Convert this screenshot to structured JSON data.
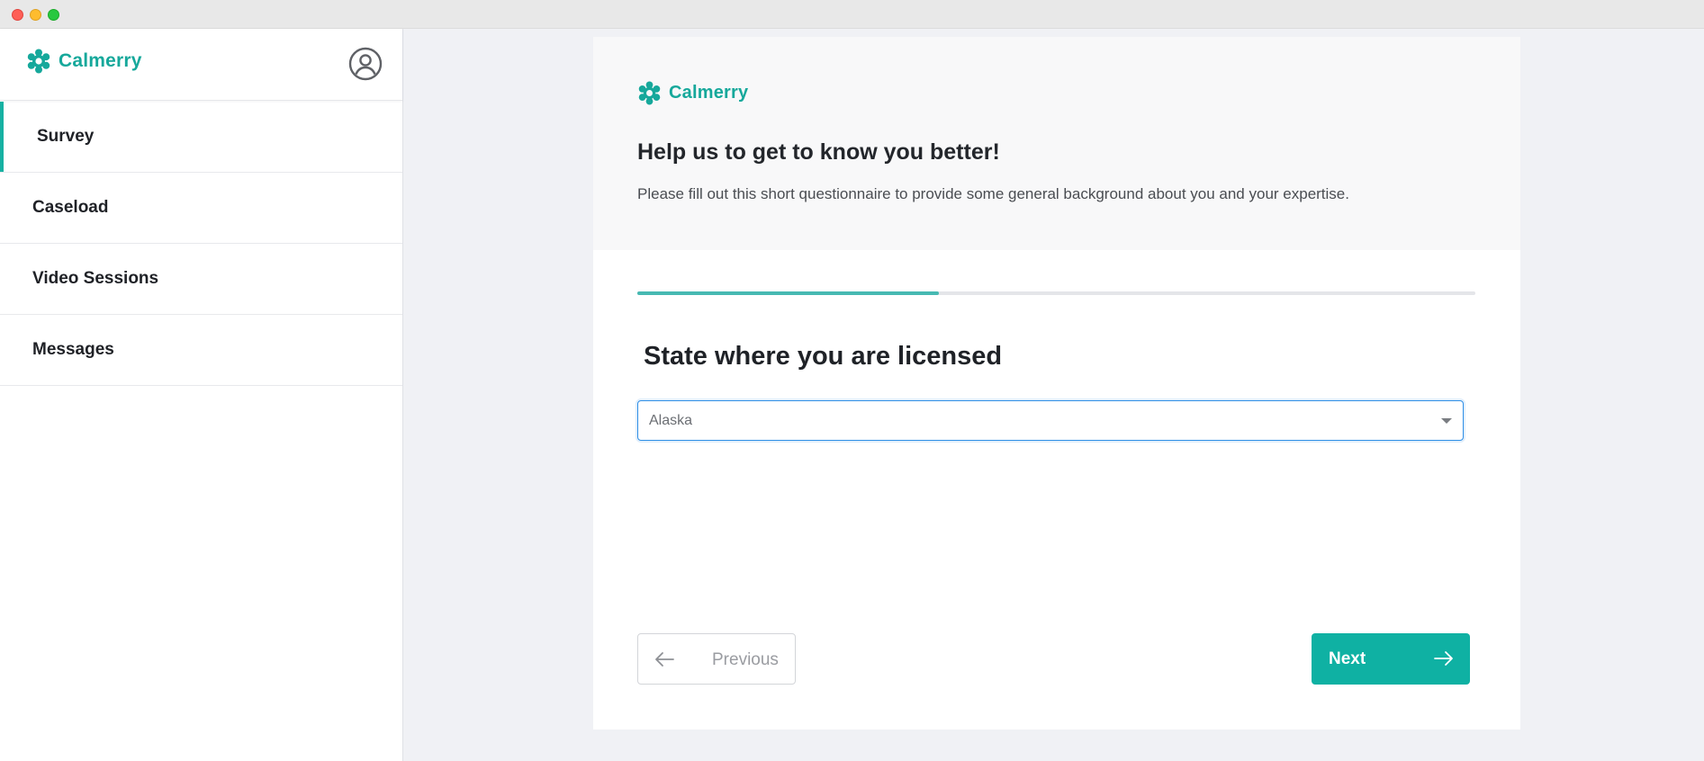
{
  "app": {
    "brand_name": "Calmerry",
    "brand_color": "#16a89b"
  },
  "sidebar": {
    "items": [
      {
        "label": "Survey",
        "active": true
      },
      {
        "label": "Caseload",
        "active": false
      },
      {
        "label": "Video Sessions",
        "active": false
      },
      {
        "label": "Messages",
        "active": false
      }
    ],
    "avatar_icon": "user-circle-icon"
  },
  "survey": {
    "intro_title": "Help us to get to know you better!",
    "intro_text": "Please fill out this short questionnaire to provide some general background about you and your expertise.",
    "progress": 0.36,
    "question": "State where you are licensed",
    "select_value": "Alaska",
    "previous_label": "Previous",
    "next_label": "Next"
  },
  "colors": {
    "accent": "#0fb1a3",
    "progress": "#47b9b2",
    "focus": "#2f8fe6"
  }
}
